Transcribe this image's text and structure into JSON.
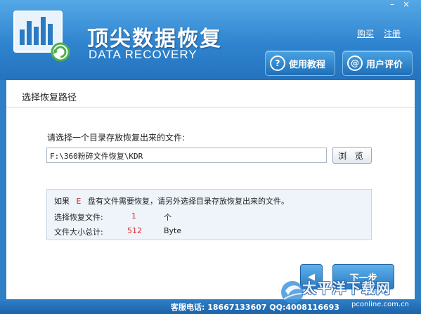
{
  "window": {
    "minimize": "–",
    "close": "×"
  },
  "header": {
    "title": "顶尖数据恢复",
    "subtitle": "DATA RECOVERY",
    "buy_link": "购买",
    "register_link": "注册",
    "tutorial_label": "使用教程",
    "review_label": "用户评价"
  },
  "panel": {
    "title": "选择恢复路径",
    "prompt": "请选择一个目录存放恢复出来的文件:",
    "path_value": "F:\\360粉碎文件恢复\\KDR",
    "browse_label": "浏 览",
    "info": {
      "line1_prefix": "如果",
      "drive": "E",
      "line1_suffix": "盘有文件需要恢复，请另外选择目录存放恢复出来的文件。",
      "files_label": "选择恢复文件:",
      "files_count": "1",
      "files_unit": "个",
      "size_label": "文件大小总计:",
      "size_value": "512",
      "size_unit": "Byte"
    },
    "next_label": "下一步"
  },
  "footer": {
    "service_text": "客服电话: 18667133607 QQ:4008116693"
  },
  "watermark": {
    "text": "太平洋下载网",
    "url": "pconline.com.cn"
  },
  "colors": {
    "header_top": "#55a8e6",
    "header_bottom": "#2572bd",
    "accent_red": "#d52b2b"
  }
}
